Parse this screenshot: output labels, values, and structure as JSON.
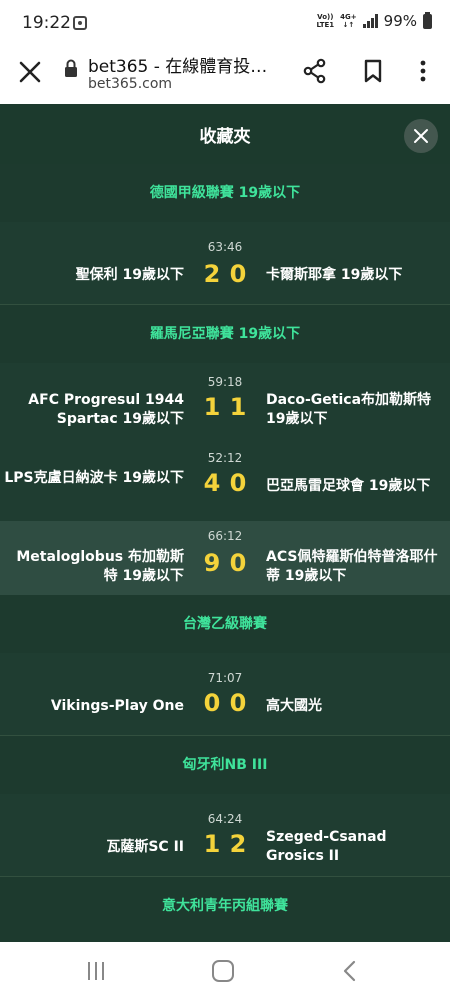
{
  "status_bar": {
    "time": "19:22",
    "net_line1": "Vo))",
    "net_line2": "LTE1",
    "net_type_top": "4G+",
    "net_type_bottom": "↓↑",
    "battery": "99%"
  },
  "browser": {
    "title": "bet365 - 在線體育投…",
    "domain": "bet365.com"
  },
  "panel": {
    "title": "收藏夾"
  },
  "leagues": [
    {
      "name": "德國甲級聯賽 19歲以下",
      "matches": [
        {
          "time": "63:46",
          "home": "聖保利 19歲以下",
          "away": "卡爾斯耶拿 19歲以下",
          "home_score": "2",
          "away_score": "0"
        }
      ]
    },
    {
      "name": "羅馬尼亞聯賽 19歲以下",
      "matches": [
        {
          "time": "59:18",
          "home": "AFC Progresul 1944 Spartac 19歲以下",
          "away": "Daco-Getica布加勒斯特 19歲以下",
          "home_score": "1",
          "away_score": "1"
        },
        {
          "time": "52:12",
          "home": "LPS克盧日納波卡 19歲以下",
          "away": "巴亞馬雷足球會 19歲以下",
          "home_score": "4",
          "away_score": "0"
        },
        {
          "time": "66:12",
          "home": "Metaloglobus 布加勒斯特 19歲以下",
          "away": "ACS佩特羅斯伯特普洛耶什蒂 19歲以下",
          "home_score": "9",
          "away_score": "0"
        }
      ]
    },
    {
      "name": "台灣乙級聯賽",
      "matches": [
        {
          "time": "71:07",
          "home": "Vikings-Play One",
          "away": "高大國光",
          "home_score": "0",
          "away_score": "0"
        }
      ]
    },
    {
      "name": "匈牙利NB III",
      "matches": [
        {
          "time": "64:24",
          "home": "瓦薩斯SC II",
          "away": "Szeged-Csanad Grosics II",
          "home_score": "1",
          "away_score": "2"
        }
      ]
    },
    {
      "name": "意大利青年丙組聯賽",
      "matches": []
    }
  ],
  "colors": {
    "background": "#1d3a2e",
    "league_title": "#3fe39b",
    "score": "#f4d33b",
    "highlight_row": "#2f4d42"
  },
  "icons": [
    "close-icon",
    "lock-icon",
    "share-icon",
    "bookmark-icon",
    "more-vertical-icon",
    "recent-apps-icon",
    "home-icon",
    "back-icon"
  ]
}
